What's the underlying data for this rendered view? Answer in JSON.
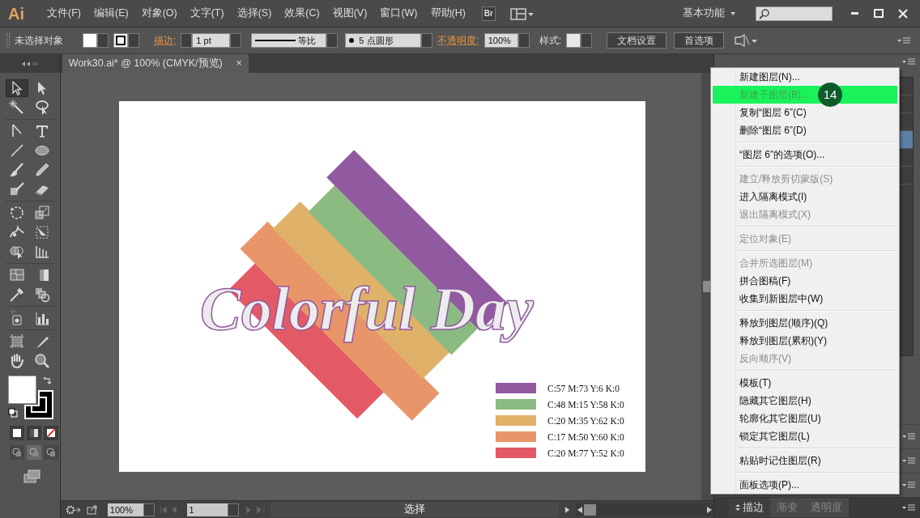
{
  "app": {
    "logo": "Ai",
    "menus": [
      "文件(F)",
      "编辑(E)",
      "对象(O)",
      "文字(T)",
      "选择(S)",
      "效果(C)",
      "视图(V)",
      "窗口(W)",
      "帮助(H)"
    ],
    "bridge_button": "Br",
    "workspace": "基本功能"
  },
  "control_bar": {
    "selection": "未选择对象",
    "stroke_label": "描边:",
    "stroke_weight": "1 pt",
    "stroke_profile": "等比",
    "brush": "5 点圆形",
    "opacity_label": "不透明度:",
    "opacity": "100%",
    "style_label": "样式:",
    "buttons": [
      "文档设置",
      "首选项"
    ]
  },
  "document_tab": {
    "title": "Work30.ai* @ 100% (CMYK/预览)",
    "close": "×"
  },
  "tools": [
    {
      "selected": true
    },
    {
      "selected": false
    },
    {
      "selected": false
    },
    {
      "selected": false
    },
    {
      "selected": false
    },
    {
      "selected": false
    },
    {
      "selected": false
    },
    {
      "selected": false
    },
    {
      "selected": false
    },
    {
      "selected": false
    },
    {
      "selected": false
    },
    {
      "selected": false
    },
    {
      "selected": false
    },
    {
      "selected": false
    },
    {
      "selected": false
    },
    {
      "selected": false
    },
    {
      "selected": false
    },
    {
      "selected": false
    },
    {
      "selected": false
    },
    {
      "selected": false
    },
    {
      "selected": false
    },
    {
      "selected": false
    },
    {
      "selected": false
    },
    {
      "selected": false
    },
    {
      "selected": false
    },
    {
      "selected": false
    },
    {
      "selected": false
    },
    {
      "selected": false
    }
  ],
  "artwork": {
    "title": "Colorful Day",
    "legend": [
      {
        "label": "C:57 M:73 Y:6 K:0",
        "color": "#9159a0"
      },
      {
        "label": "C:48 M:15 Y:58 K:0",
        "color": "#8bbb82"
      },
      {
        "label": "C:20 M:35 Y:62 K:0",
        "color": "#e0b168"
      },
      {
        "label": "C:17 M:50 Y:60 K:0",
        "color": "#e9956a"
      },
      {
        "label": "C:20 M:77 Y:52 K:0",
        "color": "#e35a66"
      }
    ]
  },
  "context_menu": {
    "step_badge": "14",
    "groups": [
      [
        {
          "label": "新建图层(N)...",
          "disabled": false,
          "selected": false
        },
        {
          "label": "新建子图层(B)...",
          "disabled": true,
          "selected": true
        },
        {
          "label": "复制“图层 6”(C)",
          "disabled": false,
          "selected": false
        },
        {
          "label": "删除“图层 6”(D)",
          "disabled": false,
          "selected": false
        }
      ],
      [
        {
          "label": "“图层 6”的选项(O)...",
          "disabled": false,
          "selected": false
        }
      ],
      [
        {
          "label": "建立/释放剪切蒙版(S)",
          "disabled": true,
          "selected": false
        },
        {
          "label": "进入隔离模式(I)",
          "disabled": false,
          "selected": false
        },
        {
          "label": "退出隔离模式(X)",
          "disabled": true,
          "selected": false
        }
      ],
      [
        {
          "label": "定位对象(E)",
          "disabled": true,
          "selected": false
        }
      ],
      [
        {
          "label": "合并所选图层(M)",
          "disabled": true,
          "selected": false
        },
        {
          "label": "拼合图稿(F)",
          "disabled": false,
          "selected": false
        },
        {
          "label": "收集到新图层中(W)",
          "disabled": false,
          "selected": false
        }
      ],
      [
        {
          "label": "释放到图层(顺序)(Q)",
          "disabled": false,
          "selected": false
        },
        {
          "label": "释放到图层(累积)(Y)",
          "disabled": false,
          "selected": false
        },
        {
          "label": "反向顺序(V)",
          "disabled": true,
          "selected": false
        }
      ],
      [
        {
          "label": "模板(T)",
          "disabled": false,
          "selected": false
        },
        {
          "label": "隐藏其它图层(H)",
          "disabled": false,
          "selected": false
        },
        {
          "label": "轮廓化其它图层(U)",
          "disabled": false,
          "selected": false
        },
        {
          "label": "锁定其它图层(L)",
          "disabled": false,
          "selected": false
        }
      ],
      [
        {
          "label": "粘贴时记住图层(R)",
          "disabled": false,
          "selected": false
        }
      ],
      [
        {
          "label": "面板选项(P)...",
          "disabled": false,
          "selected": false
        }
      ]
    ]
  },
  "panel_tabs": [
    {
      "label": "描边",
      "selected": true
    },
    {
      "label": "渐变",
      "selected": false
    },
    {
      "label": "透明度",
      "selected": false
    }
  ],
  "status_bar": {
    "zoom": "100%",
    "page": "1",
    "status": "选择"
  }
}
